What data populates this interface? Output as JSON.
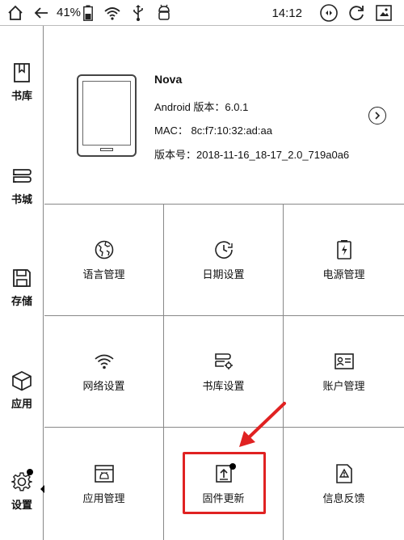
{
  "status_bar": {
    "battery_percent": "41%",
    "time": "14:12",
    "icons": [
      "home-icon",
      "back-icon",
      "battery-icon",
      "wifi-icon",
      "usb-icon",
      "android-icon",
      "volume-icon",
      "refresh-icon",
      "screenshot-icon"
    ]
  },
  "sidebar": {
    "items": [
      {
        "label": "书库",
        "icon": "library-icon"
      },
      {
        "label": "书城",
        "icon": "bookstore-icon"
      },
      {
        "label": "存储",
        "icon": "storage-icon"
      },
      {
        "label": "应用",
        "icon": "apps-icon"
      },
      {
        "label": "设置",
        "icon": "settings-icon",
        "selected": true
      }
    ]
  },
  "device": {
    "name": "Nova",
    "android_version": "Android 版本：6.0.1",
    "mac": "MAC：  8c:f7:10:32:ad:aa",
    "build": "版本号：2018-11-16_18-17_2.0_719a0a6"
  },
  "settings": {
    "items": [
      {
        "label": "语言管理",
        "icon": "language-icon"
      },
      {
        "label": "日期设置",
        "icon": "date-icon"
      },
      {
        "label": "电源管理",
        "icon": "power-icon"
      },
      {
        "label": "网络设置",
        "icon": "network-icon"
      },
      {
        "label": "书库设置",
        "icon": "library-settings-icon"
      },
      {
        "label": "账户管理",
        "icon": "account-icon"
      },
      {
        "label": "应用管理",
        "icon": "app-management-icon"
      },
      {
        "label": "固件更新",
        "icon": "firmware-update-icon",
        "highlighted": true
      },
      {
        "label": "信息反馈",
        "icon": "feedback-icon"
      }
    ]
  },
  "colors": {
    "highlight": "#e02222"
  }
}
